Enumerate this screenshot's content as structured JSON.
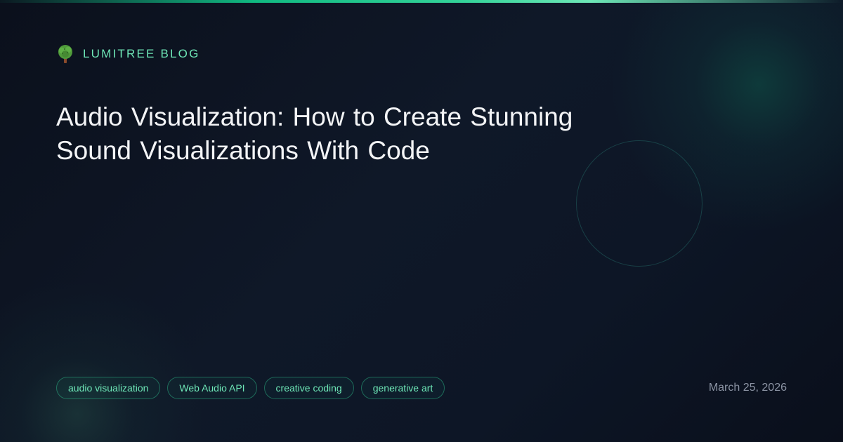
{
  "brand": {
    "name": "LUMITREE BLOG",
    "icon": "tree-icon"
  },
  "article": {
    "title": "Audio Visualization: How to Create Stunning Sound Visualizations With Code",
    "date": "March 25, 2026"
  },
  "tags": [
    "audio visualization",
    "Web Audio API",
    "creative coding",
    "generative art"
  ],
  "colors": {
    "background": "#0c1220",
    "accent": "#10b981",
    "accent_light": "#6ee7b7",
    "title_text": "#f3f4f6",
    "muted_text": "#8b93a3"
  }
}
